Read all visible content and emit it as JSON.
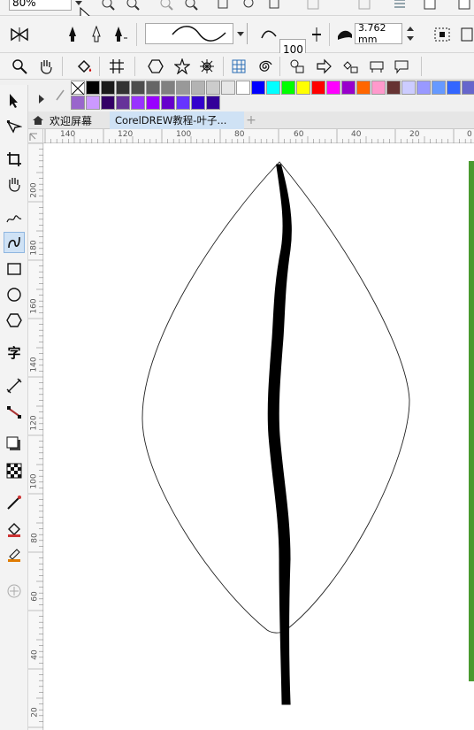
{
  "toolbar1": {
    "zoom_value": "80%"
  },
  "toolbar2": {
    "smoothing_value": "100",
    "outline_width": "3.762 mm"
  },
  "palette": {
    "row1": [
      "#000000",
      "#1a1a1a",
      "#333333",
      "#4d4d4d",
      "#666666",
      "#808080",
      "#999999",
      "#b3b3b3",
      "#cccccc",
      "#e6e6e6",
      "#ffffff",
      "#0000ff",
      "#00ffff",
      "#00ff00",
      "#ffff00",
      "#ff0000",
      "#ff00ff",
      "#9900cc",
      "#ff6600",
      "#ff99cc",
      "#663333",
      "#ccccff",
      "#9999ff",
      "#6699ff",
      "#3366ff",
      "#6666cc"
    ],
    "row2": [
      "#9966cc",
      "#cc99ff",
      "#330066",
      "#663399",
      "#9933ff",
      "#9900ff",
      "#6600cc",
      "#6633ff",
      "#3300cc",
      "#330099"
    ]
  },
  "toolbar3": {
    "fill_color": "#5cae86"
  },
  "tabs": {
    "welcome": "欢迎屏幕",
    "document": "CorelDREW教程-叶子..."
  },
  "ruler": {
    "h_labels": [
      "140",
      "120",
      "100",
      "80",
      "60",
      "40",
      "20",
      "0"
    ],
    "v_labels": [
      "200",
      "180",
      "160",
      "140",
      "120",
      "100",
      "80",
      "60",
      "40",
      "20"
    ]
  },
  "canvas": {
    "page_border_color": "#4a9a2f"
  }
}
